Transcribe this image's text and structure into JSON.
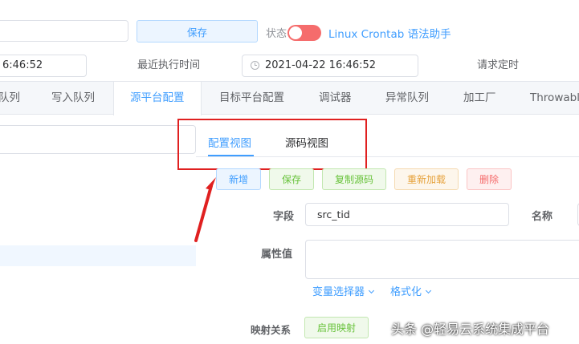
{
  "toolbar": {
    "save_label": "保存",
    "status_label": "状态",
    "crontab_link": "Linux Crontab 语法助手"
  },
  "times": {
    "left_time": "6:46:52",
    "last_exec_label": "最近执行时间",
    "last_exec_value": "2021-04-22 16:46:52",
    "request_timing_label": "请求定时"
  },
  "tabs": [
    {
      "label": "队列"
    },
    {
      "label": "写入队列"
    },
    {
      "label": "源平台配置"
    },
    {
      "label": "目标平台配置"
    },
    {
      "label": "调试器"
    },
    {
      "label": "异常队列"
    },
    {
      "label": "加工厂"
    },
    {
      "label": "Throwable"
    }
  ],
  "view_tabs": {
    "config_view": "配置视图",
    "source_view": "源码视图"
  },
  "actions": {
    "add": "新增",
    "save": "保存",
    "copy_source": "复制源码",
    "reload": "重新加载",
    "delete": "删除"
  },
  "form": {
    "field_label": "字段",
    "field_value": "src_tid",
    "name_label": "名称",
    "attr_label": "属性值",
    "var_selector": "变量选择器",
    "format": "格式化",
    "mapping_label": "映射关系",
    "enable_mapping": "启用映射"
  },
  "watermark": "头条 @轻易云系统集成平台",
  "colors": {
    "accent": "#409eff",
    "toggle_red": "#f56c6c",
    "highlight_red": "#e02020",
    "success": "#67c23a",
    "warning": "#e6a23c"
  }
}
